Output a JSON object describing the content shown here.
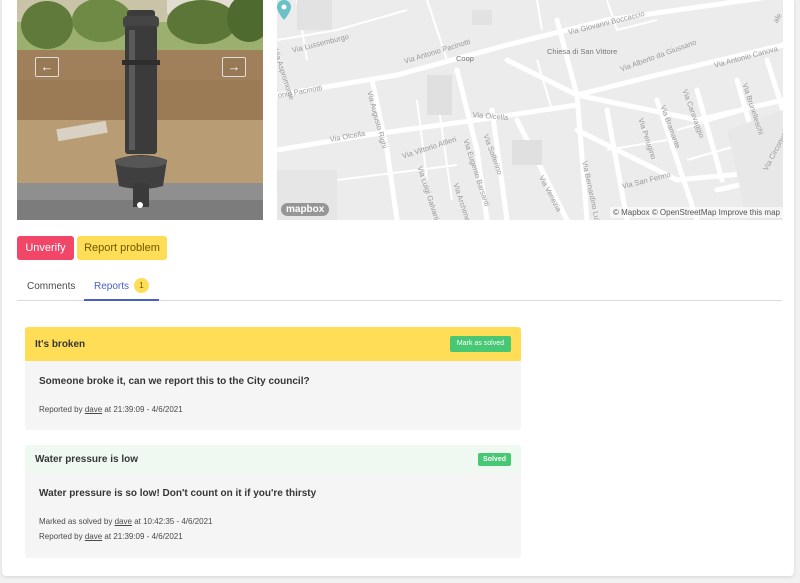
{
  "photo": {
    "prev_icon": "arrow-left-icon",
    "next_icon": "arrow-right-icon",
    "prev_symbol": "←",
    "next_symbol": "→"
  },
  "map": {
    "poi": [
      "Coop",
      "Chiesa di San Vittore"
    ],
    "roads": [
      "Via Giovanni Boccaccio",
      "Via Lussemburgo",
      "Via Antonio Pacinotti",
      "Via Alberto da Giussano",
      "Via Antonio Canova",
      "onio Pacinotti",
      "Via Olcella",
      "Via Olcella",
      "Via Augusto Righi",
      "Via Vittorio Alfieri",
      "Via Solferino",
      "Via Eugenio Barsanti",
      "Via Luigi Galvani",
      "Via Archimede",
      "Via Venezia",
      "Via Bernardino Luini",
      "Via San Fermo",
      "Via Perugino",
      "Via Bramante",
      "Via Caravaggio",
      "Via Brunelleschi",
      "Via Circonvallazione",
      "Via Aspromonte",
      "ale"
    ],
    "logo": "mapbox",
    "attribution": "© Mapbox © OpenStreetMap Improve this map",
    "pin_color": "#6bc1c9"
  },
  "actions": {
    "unverify": "Unverify",
    "report_problem": "Report problem"
  },
  "tabs": {
    "comments": "Comments",
    "reports": "Reports",
    "reports_count": "1"
  },
  "reports": [
    {
      "title": "It's broken",
      "action": "Mark as solved",
      "text": "Someone broke it, can we report this to the City council?",
      "reported_prefix": "Reported by",
      "reporter": "dave",
      "reported_at": "at 21:39:09 - 4/6/2021"
    },
    {
      "title": "Water pressure is low",
      "status": "Solved",
      "text": "Water pressure is so low! Don't count on it if you're thirsty",
      "solved_prefix": "Marked as solved by",
      "solver": "dave",
      "solved_at": "at 10:42:35 - 4/6/2021",
      "reported_prefix": "Reported by",
      "reporter": "dave",
      "reported_at": "at 21:39:09 - 4/6/2021"
    }
  ],
  "colors": {
    "danger": "#f14668",
    "warning": "#ffdd57",
    "success": "#48c774",
    "link": "#485fc7"
  }
}
